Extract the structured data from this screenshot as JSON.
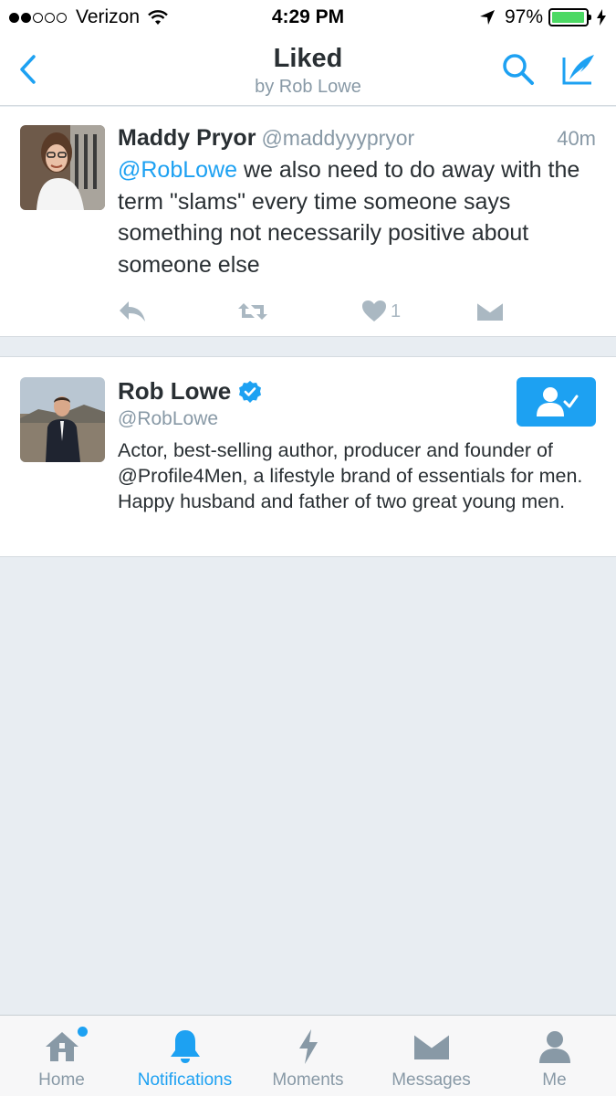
{
  "status_bar": {
    "carrier": "Verizon",
    "time": "4:29 PM",
    "battery": "97%",
    "battery_level": 0.97,
    "signal_bars": 2
  },
  "header": {
    "title": "Liked",
    "subtitle": "by Rob Lowe",
    "icons": [
      "back-chevron-icon",
      "search-icon",
      "compose-tweet-icon"
    ]
  },
  "tweet": {
    "name": "Maddy Pryor",
    "handle": "@maddyyypryor",
    "time": "40m",
    "mention": "@RobLowe",
    "text": " we also need to do away with the term \"slams\" every time someone says something not necessarily positive about someone else",
    "like_count": "1"
  },
  "user_card": {
    "name": "Rob Lowe",
    "handle": "@RobLowe",
    "bio": "Actor, best-selling author, producer and founder of @Profile4Men, a lifestyle brand of essentials for men. Happy husband and father of two great young men.",
    "verified": true
  },
  "tabs": [
    {
      "label": "Home",
      "icon": "home-icon"
    },
    {
      "label": "Notifications",
      "icon": "bell-icon"
    },
    {
      "label": "Moments",
      "icon": "lightning-icon"
    },
    {
      "label": "Messages",
      "icon": "envelope-icon"
    },
    {
      "label": "Me",
      "icon": "person-icon"
    }
  ],
  "colors": {
    "accent": "#1da1f2",
    "text": "#292f33",
    "muted": "#8899a6",
    "background": "#e8edf2"
  }
}
